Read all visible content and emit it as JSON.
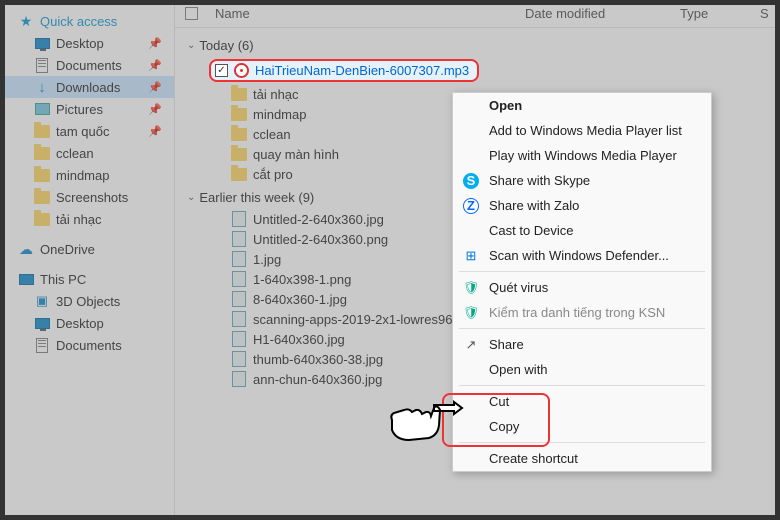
{
  "sidebar": {
    "quick_access": {
      "label": "Quick access"
    },
    "items": [
      {
        "label": "Desktop",
        "pinned": true
      },
      {
        "label": "Documents",
        "pinned": true
      },
      {
        "label": "Downloads",
        "pinned": true,
        "active": true
      },
      {
        "label": "Pictures",
        "pinned": true
      },
      {
        "label": "tam quốc",
        "pinned": true
      },
      {
        "label": "cclean"
      },
      {
        "label": "mindmap"
      },
      {
        "label": "Screenshots"
      },
      {
        "label": "tải nhạc"
      }
    ],
    "onedrive": {
      "label": "OneDrive"
    },
    "this_pc": {
      "label": "This PC"
    },
    "pc_items": [
      {
        "label": "3D Objects"
      },
      {
        "label": "Desktop"
      },
      {
        "label": "Documents"
      }
    ]
  },
  "columns": {
    "name": "Name",
    "date": "Date modified",
    "type": "Type",
    "s": "S"
  },
  "groups": {
    "today": {
      "label": "Today (6)"
    },
    "earlier": {
      "label": "Earlier this week (9)"
    }
  },
  "selected_file": "HaiTrieuNam-DenBien-6007307.mp3",
  "today_files": [
    "tải nhạc",
    "mindmap",
    "cclean",
    "quay màn hình",
    "cắt pro"
  ],
  "earlier_files": [
    "Untitled-2-640x360.jpg",
    "Untitled-2-640x360.png",
    "1.jpg",
    "1-640x398-1.png",
    "8-640x360-1.jpg",
    "scanning-apps-2019-2x1-lowres96",
    "H1-640x360.jpg",
    "thumb-640x360-38.jpg",
    "ann-chun-640x360.jpg"
  ],
  "context_menu": {
    "open": "Open",
    "add_wmp": "Add to Windows Media Player list",
    "play_wmp": "Play with Windows Media Player",
    "share_skype": "Share with Skype",
    "share_zalo": "Share with Zalo",
    "cast": "Cast to Device",
    "scan_def": "Scan with Windows Defender...",
    "quet_virus": "Quét virus",
    "ksn": "Kiểm tra danh tiếng trong KSN",
    "share": "Share",
    "open_with": "Open with",
    "cut": "Cut",
    "copy": "Copy",
    "create_shortcut": "Create shortcut"
  }
}
